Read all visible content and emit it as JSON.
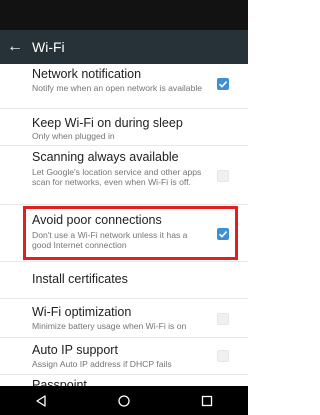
{
  "app_bar": {
    "back_icon": "arrow-back-icon",
    "title": "Wi-Fi"
  },
  "settings": [
    {
      "title": "Network notification",
      "subtitle": "Notify me when an open network is available",
      "checkbox": true
    },
    {
      "title": "Keep Wi-Fi on during sleep",
      "subtitle": "Only when plugged in",
      "checkbox": null
    },
    {
      "title": "Scanning always available",
      "subtitle": "Let Google's location service and other apps scan for networks, even when Wi-Fi is off.",
      "checkbox": false
    },
    {
      "title": "Avoid poor connections",
      "subtitle": "Don't use a Wi-Fi network unless it has a good Internet connection",
      "checkbox": true
    },
    {
      "title": "Install certificates",
      "subtitle": "",
      "checkbox": null
    },
    {
      "title": "Wi-Fi optimization",
      "subtitle": "Minimize battery usage when Wi-Fi is on",
      "checkbox": false
    },
    {
      "title": "Auto IP support",
      "subtitle": "Assign Auto IP address if DHCP fails",
      "checkbox": false
    },
    {
      "title": "Passpoint",
      "subtitle": "",
      "checkbox": null
    }
  ],
  "nav_bar": {
    "back_icon": "triangle-back-icon",
    "home_icon": "circle-home-icon",
    "recents_icon": "square-recents-icon"
  },
  "colors": {
    "app_bar": "#263238",
    "accent": "#3d8fd6",
    "highlight": "#e02020"
  }
}
